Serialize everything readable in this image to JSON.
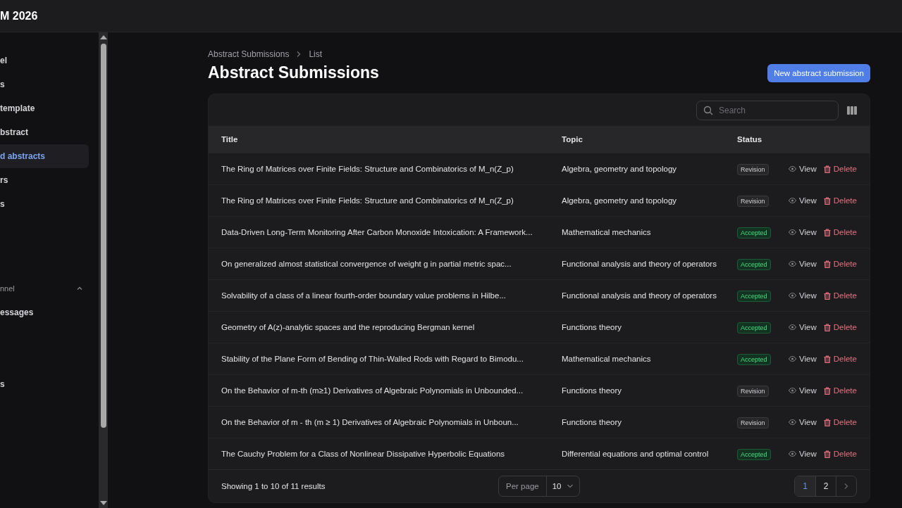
{
  "topbar": {
    "brand": "M 2026"
  },
  "sidebar": {
    "items": [
      {
        "label": "el",
        "selected": false
      },
      {
        "label": "s",
        "selected": false
      },
      {
        "label": "template",
        "selected": false
      },
      {
        "label": "bstract",
        "selected": false
      },
      {
        "label": "d abstracts",
        "selected": true
      },
      {
        "label": "rs",
        "selected": false
      },
      {
        "label": "s",
        "selected": false
      }
    ],
    "group": {
      "label": "nnel",
      "expanded": true,
      "items": [
        {
          "label": "essages",
          "selected": false
        }
      ]
    },
    "footer_items": [
      {
        "label": "s",
        "selected": false
      }
    ]
  },
  "breadcrumbs": [
    "Abstract Submissions",
    "List"
  ],
  "page_title": "Abstract Submissions",
  "new_button": "New abstract submission",
  "search": {
    "placeholder": "Search"
  },
  "table": {
    "columns": [
      "Title",
      "Topic",
      "Status"
    ],
    "rows": [
      {
        "title": "The Ring of Matrices over Finite Fields: Structure and Combinatorics of M_n(Z_p)",
        "topic": "Algebra, geometry and topology",
        "status": "Revision",
        "kind": "revision",
        "view": "View",
        "delete": "Delete"
      },
      {
        "title": "The Ring of Matrices over Finite Fields: Structure and Combinatorics of M_n(Z_p)",
        "topic": "Algebra, geometry and topology",
        "status": "Revision",
        "kind": "revision",
        "view": "View",
        "delete": "Delete"
      },
      {
        "title": "Data-Driven Long-Term Monitoring After Carbon Monoxide Intoxication: A Framework...",
        "topic": "Mathematical mechanics",
        "status": "Accepted",
        "kind": "accepted",
        "view": "View",
        "delete": "Delete"
      },
      {
        "title": "On generalized almost statistical convergence of weight g in partial metric spac...",
        "topic": "Functional analysis and theory of operators",
        "status": "Accepted",
        "kind": "accepted",
        "view": "View",
        "delete": "Delete"
      },
      {
        "title": "Solvability of a class of a linear fourth-order boundary value problems in Hilbe...",
        "topic": "Functional analysis and theory of operators",
        "status": "Accepted",
        "kind": "accepted",
        "view": "View",
        "delete": "Delete"
      },
      {
        "title": "Geometry of A(z)-analytic spaces and the reproducing Bergman kernel",
        "topic": "Functions theory",
        "status": "Accepted",
        "kind": "accepted",
        "view": "View",
        "delete": "Delete"
      },
      {
        "title": "Stability of the Plane Form of Bending of Thin-Walled Rods with Regard to Bimodu...",
        "topic": "Mathematical mechanics",
        "status": "Accepted",
        "kind": "accepted",
        "view": "View",
        "delete": "Delete"
      },
      {
        "title": "On the Behavior of m-th (m≥1) Derivatives of Algebraic Polynomials in Unbounded...",
        "topic": "Functions theory",
        "status": "Revision",
        "kind": "revision",
        "view": "View",
        "delete": "Delete"
      },
      {
        "title": "On the Behavior of m - th (m ≥ 1) Derivatives of Algebraic Polynomials in Unboun...",
        "topic": "Functions theory",
        "status": "Revision",
        "kind": "revision",
        "view": "View",
        "delete": "Delete"
      },
      {
        "title": "The Cauchy Problem for a Class of Nonlinear Dissipative Hyperbolic Equations",
        "topic": "Differential equations and optimal control",
        "status": "Accepted",
        "kind": "accepted",
        "view": "View",
        "delete": "Delete"
      }
    ]
  },
  "footer": {
    "summary": "Showing 1 to 10 of 11 results",
    "per_page_label": "Per page",
    "per_page": "10",
    "pages": [
      {
        "label": "1",
        "selected": true
      },
      {
        "label": "2",
        "selected": false
      }
    ]
  }
}
